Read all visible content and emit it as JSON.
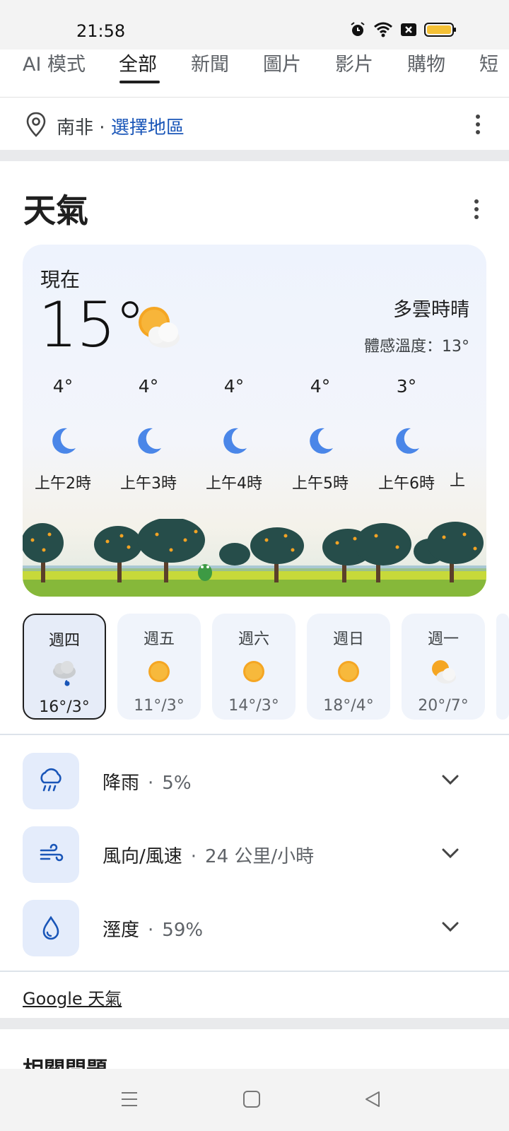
{
  "status_bar": {
    "time": "21:58"
  },
  "tabs": [
    {
      "label": "AI 模式"
    },
    {
      "label": "全部",
      "active": true
    },
    {
      "label": "新聞"
    },
    {
      "label": "圖片"
    },
    {
      "label": "影片"
    },
    {
      "label": "購物"
    },
    {
      "label": "短"
    }
  ],
  "location": {
    "place": "南非",
    "separator": " · ",
    "link": "選擇地區"
  },
  "weather": {
    "title": "天氣",
    "now_label": "現在",
    "temperature": "15°",
    "condition": "多雲時晴",
    "feels_like": "體感溫度：13°",
    "hourly": [
      {
        "temp": "4°",
        "icon": "moon-icon",
        "time": "上午2時"
      },
      {
        "temp": "4°",
        "icon": "moon-icon",
        "time": "上午3時"
      },
      {
        "temp": "4°",
        "icon": "moon-icon",
        "time": "上午4時"
      },
      {
        "temp": "4°",
        "icon": "moon-icon",
        "time": "上午5時"
      },
      {
        "temp": "3°",
        "icon": "moon-icon",
        "time": "上午6時"
      },
      {
        "temp": "",
        "icon": "",
        "time": "上"
      }
    ],
    "daily": [
      {
        "day": "週四",
        "icon": "rain-cloud-icon",
        "temps": "16°/3°",
        "selected": true
      },
      {
        "day": "週五",
        "icon": "sun-icon",
        "temps": "11°/3°"
      },
      {
        "day": "週六",
        "icon": "sun-icon",
        "temps": "14°/3°"
      },
      {
        "day": "週日",
        "icon": "sun-icon",
        "temps": "18°/4°"
      },
      {
        "day": "週一",
        "icon": "partly-cloudy-icon",
        "temps": "20°/7°"
      }
    ],
    "details": [
      {
        "label": "降雨",
        "value": "5%",
        "icon": "rain-icon"
      },
      {
        "label": "風向/風速",
        "value": "24 公里/小時",
        "icon": "wind-icon"
      },
      {
        "label": "溼度",
        "value": "59%",
        "icon": "humidity-icon"
      }
    ],
    "source": "Google 天氣"
  },
  "related": {
    "title": "相關問題"
  },
  "colors": {
    "accent_link": "#1a56b8",
    "card_bg": "#eef3fd",
    "moon": "#4a86e8",
    "sun": "#f5a623"
  }
}
